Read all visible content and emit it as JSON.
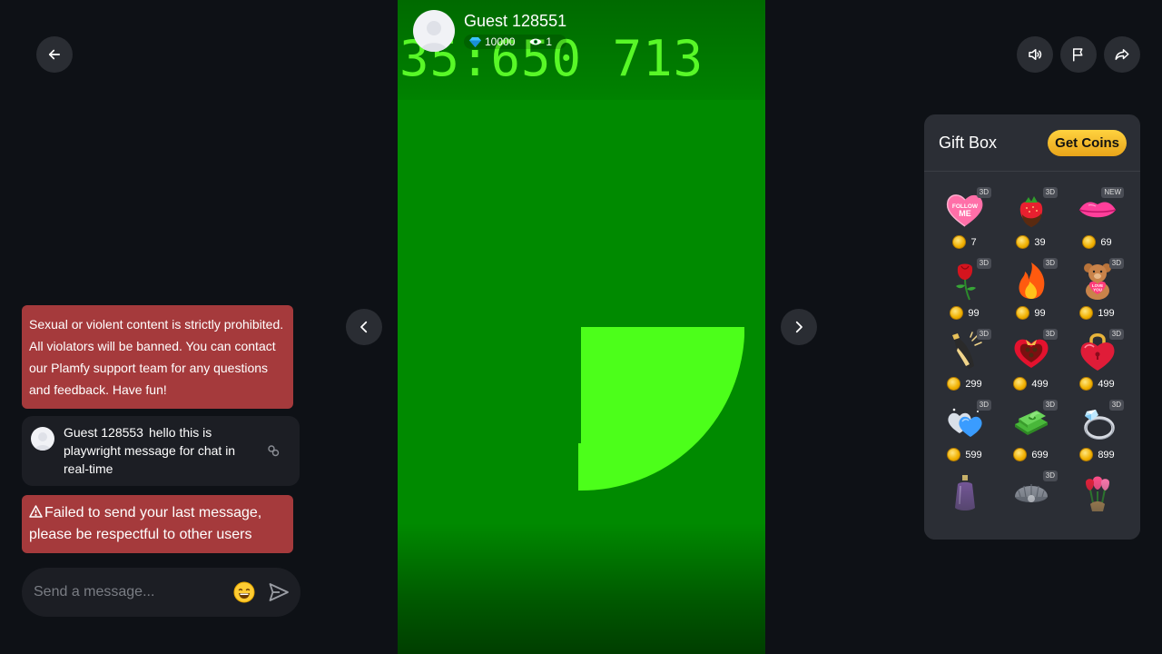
{
  "streamer": {
    "name": "Guest 128551",
    "diamonds": "10000",
    "viewers": "1"
  },
  "video": {
    "overlay_text": "35:650 713",
    "bg_color": "#008a00",
    "shape_color": "#4cff1a"
  },
  "chat": {
    "notice": "Sexual or violent content is strictly prohibited. All violators will be banned. You can contact our Plamfy support team for any questions and feedback. Have fun!",
    "message": {
      "author": "Guest 128553",
      "text": "hello this is playwright message for chat in real-time"
    },
    "error": "Failed to send your last message, please be respectful to other users",
    "input_placeholder": "Send a message..."
  },
  "gift_box": {
    "title": "Gift Box",
    "get_coins_label": "Get Coins",
    "gifts": [
      {
        "name": "follow-me-heart",
        "price": "7",
        "badge": "3D"
      },
      {
        "name": "chocolate-strawberry",
        "price": "39",
        "badge": "3D"
      },
      {
        "name": "lips",
        "price": "69",
        "badge": "NEW"
      },
      {
        "name": "rose",
        "price": "99",
        "badge": "3D"
      },
      {
        "name": "fire",
        "price": "99",
        "badge": "3D"
      },
      {
        "name": "teddy-bear",
        "price": "199",
        "badge": "3D"
      },
      {
        "name": "champagne",
        "price": "299",
        "badge": "3D"
      },
      {
        "name": "heart-chocolate-box",
        "price": "499",
        "badge": "3D"
      },
      {
        "name": "heart-lock",
        "price": "499",
        "badge": "3D"
      },
      {
        "name": "twin-hearts",
        "price": "599",
        "badge": "3D"
      },
      {
        "name": "money-stack",
        "price": "699",
        "badge": "3D"
      },
      {
        "name": "diamond-ring",
        "price": "899",
        "badge": "3D"
      },
      {
        "name": "perfume",
        "price": "",
        "badge": ""
      },
      {
        "name": "pearl-shell",
        "price": "",
        "badge": "3D"
      },
      {
        "name": "tulips",
        "price": "",
        "badge": ""
      }
    ]
  },
  "colors": {
    "accent_red": "#a53a3c",
    "coin_gold": "#f0b000",
    "panel": "#2b2e35"
  }
}
